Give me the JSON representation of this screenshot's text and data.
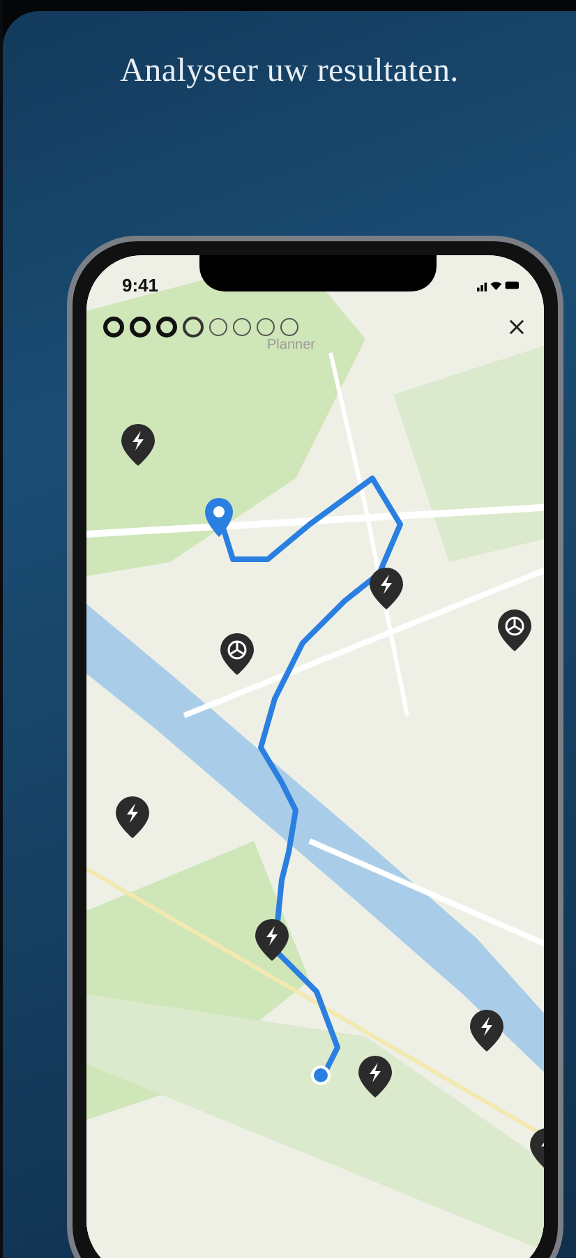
{
  "headline": "Analyseer uw resultaten.",
  "phone": {
    "status_bar": {
      "time": "9:41"
    },
    "progress_steps": [
      {
        "kind": "done"
      },
      {
        "kind": "done"
      },
      {
        "kind": "done"
      },
      {
        "kind": "current"
      },
      {
        "kind": "todo"
      },
      {
        "kind": "todo"
      },
      {
        "kind": "todo"
      },
      {
        "kind": "todo"
      }
    ],
    "screen_label": "Planner"
  }
}
